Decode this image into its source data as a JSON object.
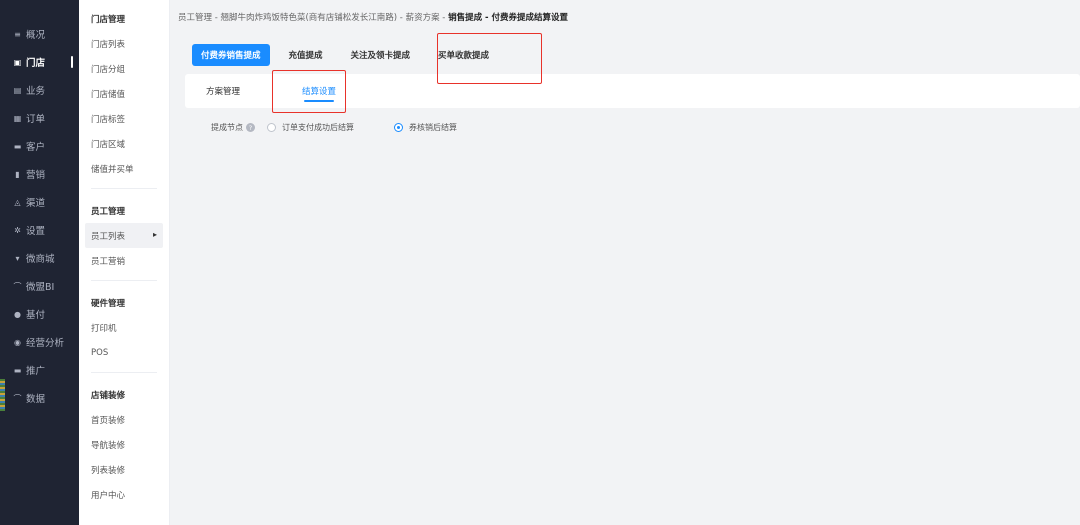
{
  "nav": {
    "items": [
      {
        "label": "概况",
        "icon": "menu-lines-icon",
        "glyph": "≡"
      },
      {
        "label": "门店",
        "icon": "store-icon",
        "glyph": "▣"
      },
      {
        "label": "业务",
        "icon": "briefcase-icon",
        "glyph": "▤"
      },
      {
        "label": "订单",
        "icon": "order-icon",
        "glyph": "▦"
      },
      {
        "label": "客户",
        "icon": "customer-card-icon",
        "glyph": "▬"
      },
      {
        "label": "营销",
        "icon": "bar-chart-icon",
        "glyph": "▮"
      },
      {
        "label": "渠道",
        "icon": "channel-icon",
        "glyph": "◬"
      },
      {
        "label": "设置",
        "icon": "gear-icon",
        "glyph": "✲"
      },
      {
        "label": "微商城",
        "icon": "mall-icon",
        "glyph": "▾"
      },
      {
        "label": "微盟BI",
        "icon": "line-chart-icon",
        "glyph": "⌒"
      },
      {
        "label": "基付",
        "icon": "pay-icon",
        "glyph": "●"
      },
      {
        "label": "经营分析",
        "icon": "analysis-icon",
        "glyph": "◉"
      },
      {
        "label": "推广",
        "icon": "promote-icon",
        "glyph": "▬"
      },
      {
        "label": "数据",
        "icon": "data-chart-icon",
        "glyph": "⌒"
      }
    ],
    "active_index": 1
  },
  "submenu": {
    "groups": [
      {
        "title": "门店管理",
        "items": [
          "门店列表",
          "门店分组",
          "门店储值",
          "门店标签",
          "门店区域",
          "储值并买单"
        ]
      },
      {
        "title": "员工管理",
        "items": [
          "员工列表",
          "员工营销"
        ]
      },
      {
        "title": "硬件管理",
        "items": [
          "打印机",
          "POS"
        ]
      },
      {
        "title": "店铺装修",
        "items": [
          "首页装修",
          "导航装修",
          "列表装修",
          "用户中心"
        ]
      }
    ],
    "active_item": "员工列表"
  },
  "breadcrumb": {
    "prefix": "员工管理 - 翘脚牛肉炸鸡饭特色菜(商有店铺松发长江南路) - 薪资方案 - ",
    "current": "销售提成 - 付费券提成结算设置"
  },
  "tabs_primary": [
    "付费券销售提成",
    "充值提成",
    "关注及领卡提成",
    "买单收款提成"
  ],
  "tabs_secondary": [
    "方案管理",
    "结算设置"
  ],
  "form": {
    "label": "提成节点",
    "help_glyph": "?",
    "options": [
      "订单支付成功后结算",
      "券核销后结算"
    ],
    "selected": 1
  },
  "colors": {
    "accent": "#1a8cff",
    "highlight": "#e8322a",
    "nav_bg": "#1f2433"
  }
}
